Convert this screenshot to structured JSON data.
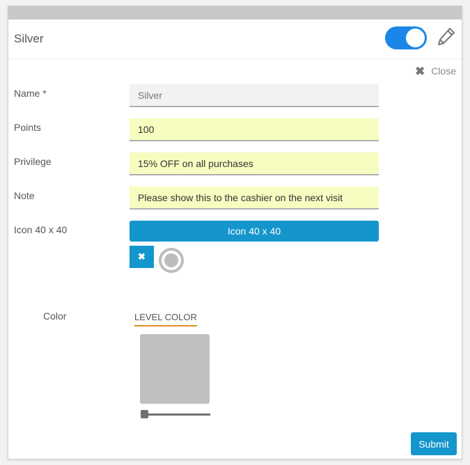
{
  "header": {
    "title": "Silver",
    "toggle_on": true,
    "toggle_color": "#1a87e8"
  },
  "close": {
    "icon": "close-icon",
    "label": "Close"
  },
  "form": {
    "name": {
      "label": "Name *",
      "value": "Silver"
    },
    "points": {
      "label": "Points",
      "value": "100"
    },
    "privilege": {
      "label": "Privilege",
      "value": "15% OFF on all purchases"
    },
    "note": {
      "label": "Note",
      "value": "Please show this to the cashier on the next visit"
    },
    "icon": {
      "label": "Icon 40 x 40",
      "button_label": "Icon 40 x 40",
      "remove_icon": "close-icon"
    },
    "color": {
      "label": "Color",
      "tab_label": "LEVEL COLOR",
      "swatch_color": "#c0c0c0",
      "slider_value": 0
    }
  },
  "actions": {
    "submit_label": "Submit"
  },
  "colors": {
    "accent": "#1496cc",
    "tab_underline": "#e08f1c",
    "highlight_field": "#f7fcc0"
  }
}
